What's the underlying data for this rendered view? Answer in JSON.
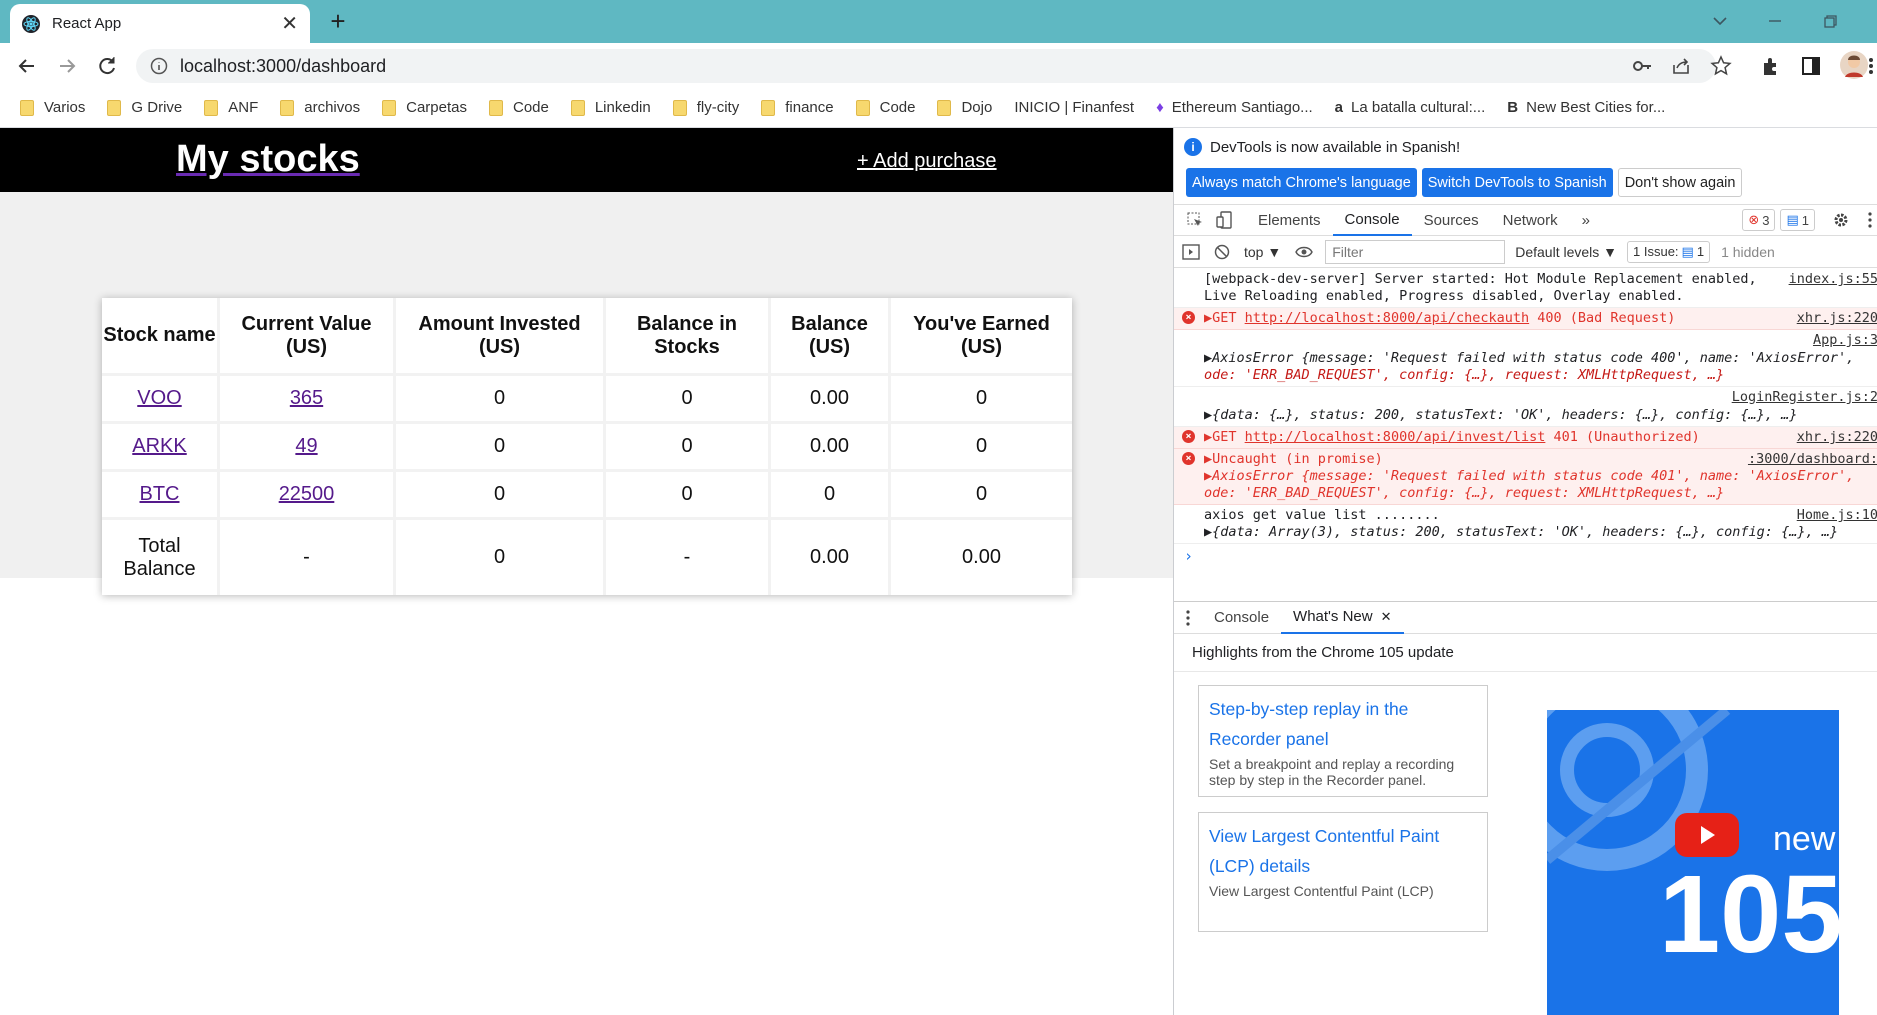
{
  "browser": {
    "tab_title": "React App",
    "tab_close": "✕",
    "new_tab": "+",
    "url": "localhost:3000/dashboard",
    "bookmarks": [
      {
        "label": "Varios",
        "icon": "folder-icon"
      },
      {
        "label": "G Drive",
        "icon": "folder-icon"
      },
      {
        "label": "ANF",
        "icon": "folder-icon"
      },
      {
        "label": "archivos",
        "icon": "folder-icon"
      },
      {
        "label": "Carpetas",
        "icon": "folder-icon"
      },
      {
        "label": "Code",
        "icon": "folder-icon"
      },
      {
        "label": "Linkedin",
        "icon": "folder-icon"
      },
      {
        "label": "fly-city",
        "icon": "folder-icon"
      },
      {
        "label": "finance",
        "icon": "folder-icon"
      },
      {
        "label": "Code",
        "icon": "folder-icon"
      },
      {
        "label": "Dojo",
        "icon": "folder-icon"
      },
      {
        "label": "INICIO | Finanfest",
        "icon": "none"
      },
      {
        "label": "Ethereum Santiago...",
        "icon": "ethereum-icon"
      },
      {
        "label": "La batalla cultural:...",
        "icon": "amazon-icon"
      },
      {
        "label": "New Best Cities for...",
        "icon": "b-logo-icon"
      }
    ]
  },
  "app": {
    "title": "My stocks",
    "add_link": "+ Add purchase",
    "headers": [
      "Stock name",
      "Current Value (US)",
      "Amount Invested (US)",
      "Balance in Stocks",
      "Balance (US)",
      "You've Earned (US)"
    ],
    "rows": [
      {
        "name": "VOO",
        "current": "365",
        "invested": "0",
        "balance_stocks": "0",
        "balance": "0.00",
        "earned": "0"
      },
      {
        "name": "ARKK",
        "current": "49",
        "invested": "0",
        "balance_stocks": "0",
        "balance": "0.00",
        "earned": "0"
      },
      {
        "name": "BTC",
        "current": "22500",
        "invested": "0",
        "balance_stocks": "0",
        "balance": "0",
        "earned": "0"
      }
    ],
    "total": {
      "name": "Total Balance",
      "current": "-",
      "invested": "0",
      "balance_stocks": "-",
      "balance": "0.00",
      "earned": "0.00"
    }
  },
  "devtools": {
    "notice": "DevTools is now available in Spanish!",
    "buttons": [
      "Always match Chrome's language",
      "Switch DevTools to Spanish",
      "Don't show again"
    ],
    "tabs": [
      "Elements",
      "Console",
      "Sources",
      "Network"
    ],
    "more_tabs": "»",
    "error_count": "3",
    "message_count": "1",
    "context": "top ▼",
    "filter_placeholder": "Filter",
    "levels": "Default levels ▼",
    "issues": "1 Issue:",
    "issues_count": "1",
    "hidden": "1 hidden",
    "console": {
      "l1a": "[webpack-dev-server] Server started: Hot Module Replacement enabled,",
      "l1b": "Live Reloading enabled, Progress disabled, Overlay enabled.",
      "l1src": "index.js:55",
      "e1_method": "▶GET ",
      "e1_url": "http://localhost:8000/api/checkauth",
      "e1_status": " 400 (Bad Request)",
      "e1_src": "xhr.js:220",
      "l2src": "App.js:3",
      "l2a": "▶AxiosError {message: 'Request failed with status code 400', name: 'AxiosError',",
      "l2b": "ode: 'ERR_BAD_REQUEST', config: {…}, request: XMLHttpRequest, …}",
      "l3src": "LoginRegister.js:2",
      "l3": "▶{data: {…}, status: 200, statusText: 'OK', headers: {…}, config: {…}, …}",
      "e2_method": "▶GET ",
      "e2_url": "http://localhost:8000/api/invest/list",
      "e2_status": " 401 (Unauthorized)",
      "e2_src": "xhr.js:220",
      "e3a": "▶Uncaught (in promise)",
      "e3src": ":3000/dashboard:",
      "e3b": "▶AxiosError {message: 'Request failed with status code 401', name: 'AxiosError',",
      "e3c": "ode: 'ERR_BAD_REQUEST', config: {…}, request: XMLHttpRequest, …}",
      "l4a": "axios get value list ........",
      "l4src": "Home.js:10",
      "l4b": "▶{data: Array(3), status: 200, statusText: 'OK', headers: {…}, config: {…}, …}",
      "prompt": "›"
    },
    "drawer": {
      "tabs": [
        "Console",
        "What's New"
      ],
      "close": "✕",
      "heading": "Highlights from the Chrome 105 update",
      "cards": [
        {
          "title": "Step-by-step replay in the Recorder panel",
          "desc": "Set a breakpoint and replay a recording step by step in the Recorder panel."
        },
        {
          "title": "View Largest Contentful Paint (LCP) details",
          "desc": "View Largest Contentful Paint (LCP)"
        }
      ],
      "promo_word": "new",
      "promo_number": "105"
    }
  },
  "colors": {
    "tabstrip": "#5fb8c2",
    "header": "#000000",
    "link": "#551a8b",
    "devtools_blue": "#1a73e8",
    "error": "#e0342c"
  }
}
